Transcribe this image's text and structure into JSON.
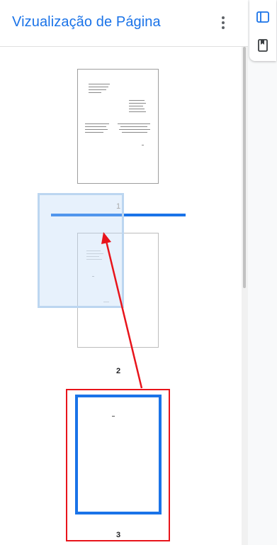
{
  "header": {
    "title": "Vizualização de Página"
  },
  "pages": [
    {
      "label": "2"
    },
    {
      "label": "3"
    }
  ],
  "drag_ghost": {
    "label": "1"
  },
  "colors": {
    "accent": "#1a73e8",
    "annotation": "#e8141b"
  },
  "icons": {
    "more": "more-vert-icon",
    "sidebar": "sidebar-icon",
    "bookmark": "bookmark-icon"
  }
}
